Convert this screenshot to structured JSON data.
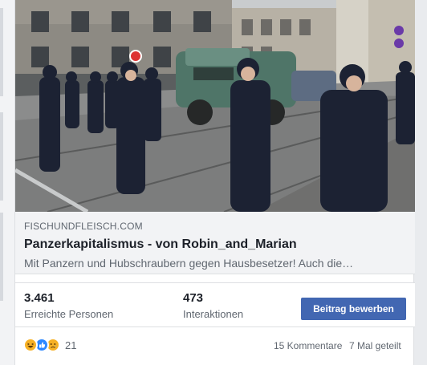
{
  "link_preview": {
    "domain": "FISCHUNDFLEISCH.COM",
    "title": "Panzerkapitalismus - von Robin_and_Marian",
    "description": "Mit Panzern und Hubschraubern gegen Hausbesetzer! Auch die…",
    "image_icon": "police-armored-vehicle-photo"
  },
  "stats": {
    "reach_value": "3.461",
    "reach_label": "Erreichte Personen",
    "engagement_value": "473",
    "engagement_label": "Interaktionen",
    "boost_label": "Beitrag bewerben"
  },
  "footer": {
    "reaction_icons": [
      "haha-icon",
      "like-icon",
      "sad-icon"
    ],
    "reaction_count": "21",
    "comments": "15 Kommentare",
    "shares": "7 Mal geteilt"
  },
  "colors": {
    "accent": "#4267b2",
    "secondary_text": "#606770",
    "link_background": "#f2f3f5"
  }
}
